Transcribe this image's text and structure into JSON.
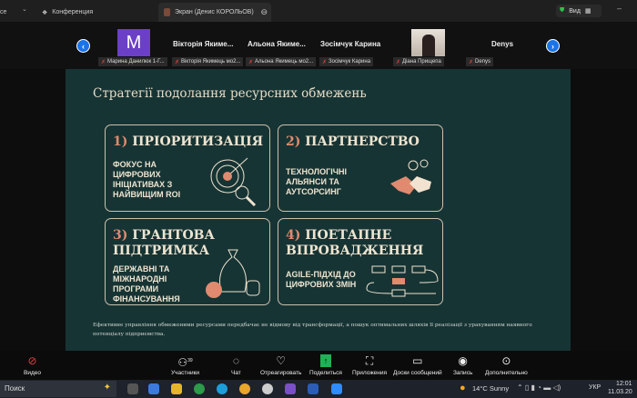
{
  "window": {
    "left_fragment": "ce",
    "tabs": [
      {
        "label": "Конференция"
      },
      {
        "label": "Экран (Денис КОРОЛЬОВ)"
      }
    ],
    "view_label": "Вид"
  },
  "participants": [
    {
      "tile": "M",
      "name": "Марина Данилюк 1-Г..."
    },
    {
      "tile": "Вікторія Якиме...",
      "name": "Вікторія Якимець мо2..."
    },
    {
      "tile": "Альона Якиме...",
      "name": "Альона Якимець мо2..."
    },
    {
      "tile": "Зосімчук Карина",
      "name": "Зосімчук Карина"
    },
    {
      "tile": "",
      "name": "Діана Прищепа"
    },
    {
      "tile": "Denys",
      "name": "Denys"
    }
  ],
  "slide": {
    "title": "Стратегії подолання ресурсних обмежень",
    "cards": [
      {
        "num": "1)",
        "title": "ПРІОРИТИЗАЦІЯ",
        "text": "Фокус на цифрових ініціативах з найвищим ROI"
      },
      {
        "num": "2)",
        "title": "ПАРТНЕРСТВО",
        "text": "Технологічні альянси та аутсорсинг"
      },
      {
        "num": "3)",
        "title": "ГРАНТОВА ПІДТРИМКА",
        "text": "Державні та міжнародні програми фінансування"
      },
      {
        "num": "4)",
        "title": "ПОЕТАПНЕ ВПРОВАДЖЕННЯ",
        "text": "Agile-підхід до цифрових змін"
      }
    ],
    "footer": "Ефективне управління обмеженими ресурсами передбачає не відмову від трансформації, а пошук оптимальних шляхів її реалізації з урахуванням наявного потенціалу підприємства."
  },
  "toolbar": {
    "video": "Видео",
    "participants": "Участники",
    "participants_count": "39",
    "chat": "Чат",
    "react": "Отреагировать",
    "share": "Поделиться",
    "apps": "Приложения",
    "boards": "Доски сообщений",
    "record": "Запись",
    "more": "Дополнительно"
  },
  "taskbar": {
    "search": "Поиск",
    "weather": "14°C  Sunny",
    "lang": "УКР",
    "time": "12:01",
    "date": "11.03.20"
  },
  "colors": {
    "slide_bg": "#173434",
    "accent": "#e08a6f",
    "zoom_blue": "#1a73e8"
  }
}
